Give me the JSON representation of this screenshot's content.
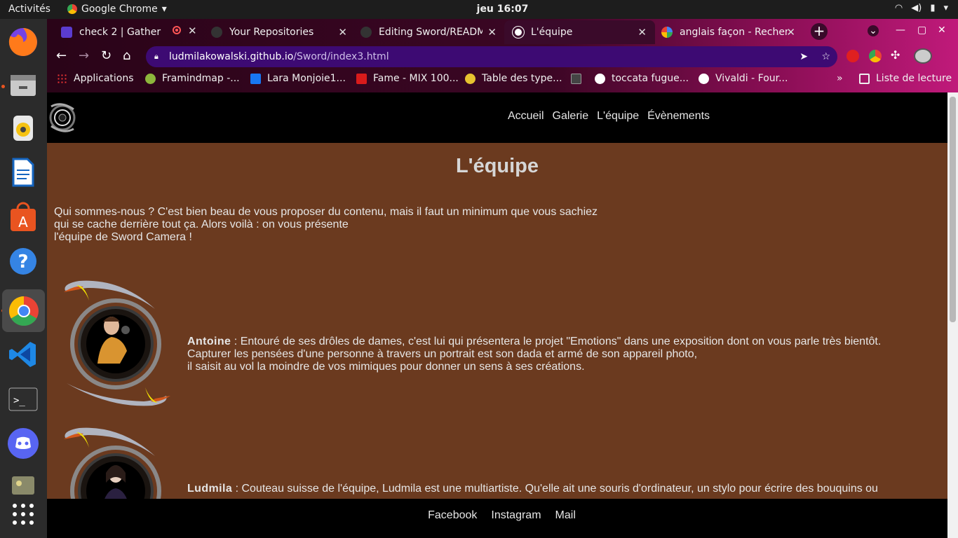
{
  "system": {
    "activities": "Activités",
    "app_name": "Google Chrome",
    "clock": "jeu 16:07"
  },
  "tabs": [
    {
      "title": "check 2 | Gather"
    },
    {
      "title": "Your Repositories"
    },
    {
      "title": "Editing Sword/READM"
    },
    {
      "title": "L'équipe",
      "active": true
    },
    {
      "title": "anglais façon - Recher"
    }
  ],
  "address_bar": {
    "domain": "ludmilakowalski.github.io",
    "path": "/Sword/index3.html"
  },
  "bookmarks": [
    {
      "label": "Applications"
    },
    {
      "label": "Framindmap -..."
    },
    {
      "label": "Lara Monjoie1..."
    },
    {
      "label": "Fame - MIX 100..."
    },
    {
      "label": "Table des type..."
    },
    {
      "label": "toccata fugue..."
    },
    {
      "label": "Vivaldi - Four..."
    }
  ],
  "bookmarks_more": "»",
  "reading_list": "Liste de lecture",
  "site": {
    "nav": [
      "Accueil",
      "Galerie",
      "L'équipe",
      "Évènements"
    ],
    "title": "L'équipe",
    "intro": [
      "Qui sommes-nous ? C'est bien beau de vous proposer du contenu, mais il faut un minimum que vous sachiez",
      "qui se cache derrière tout ça. Alors voilà : on vous présente",
      "l'équipe de Sword Camera !"
    ],
    "members": [
      {
        "name": "Antoine",
        "lines": [
          " : Entouré de ses drôles de dames, c'est lui qui présentera le projet \"Emotions\" dans une exposition dont on vous parle très bientôt.",
          "Capturer les pensées d'une personne à travers un portrait est son dada et armé de son appareil photo,",
          "il saisit au vol la moindre de vos mimiques pour donner un sens à ses créations."
        ]
      },
      {
        "name": "Ludmila",
        "lines": [
          " : Couteau suisse de l'équipe, Ludmila est une multiartiste. Qu'elle ait une souris d'ordinateur, un stylo pour écrire des bouquins ou"
        ]
      }
    ],
    "footer": [
      "Facebook",
      "Instagram",
      "Mail"
    ]
  },
  "colors": {
    "page_bg": "#6b3a1f",
    "header_bg": "#000000",
    "accent_yellow": "#f2e200",
    "omnibox": "#3d0a73"
  }
}
